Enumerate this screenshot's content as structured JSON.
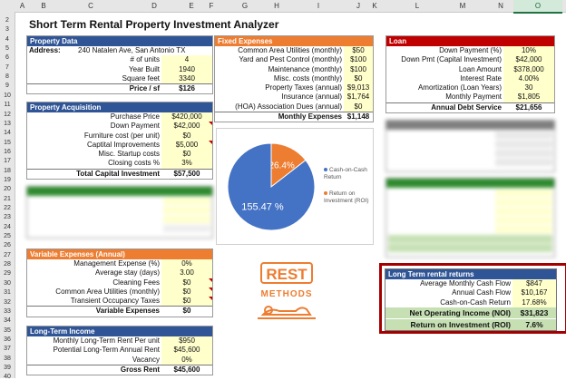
{
  "columns": [
    "A",
    "B",
    "C",
    "D",
    "E",
    "F",
    "G",
    "H",
    "I",
    "J",
    "K",
    "L",
    "M",
    "N",
    "O"
  ],
  "selected_column": "O",
  "rows": [
    "2",
    "3",
    "4",
    "5",
    "6",
    "7",
    "8",
    "9",
    "10",
    "11",
    "12",
    "13",
    "14",
    "15",
    "16",
    "17",
    "18",
    "19",
    "20",
    "21",
    "22",
    "23",
    "24",
    "25",
    "26",
    "27",
    "28",
    "29",
    "30",
    "31",
    "32",
    "33",
    "34",
    "35",
    "36",
    "37",
    "38",
    "39",
    "40"
  ],
  "title": "Short Term Rental Property Investment Analyzer",
  "property": {
    "header": "Property Data",
    "address_label": "Address:",
    "address": "240 Natalen Ave, San Antonio TX",
    "rows": [
      {
        "label": "# of units",
        "value": "4"
      },
      {
        "label": "Year Built",
        "value": "1940"
      },
      {
        "label": "Square feet",
        "value": "3340"
      }
    ],
    "price_sf_label": "Price / sf",
    "price_sf": "$126"
  },
  "acquisition": {
    "header": "Property Acquisition",
    "rows": [
      {
        "label": "Purchase Price",
        "value": "$420,000"
      },
      {
        "label": "Down Payment",
        "value": "$42,000"
      },
      {
        "label": "Furniture cost (per unit)",
        "value": "$0"
      },
      {
        "label": "Captital Improvements",
        "value": "$5,000"
      },
      {
        "label": "Misc. Startup costs",
        "value": "$0"
      },
      {
        "label": "Closing costs %",
        "value": "3%"
      }
    ],
    "total_label": "Total Capital Investment",
    "total": "$57,500"
  },
  "variable": {
    "header": "Variable Expenses (Annual)",
    "rows": [
      {
        "label": "Management Expense (%)",
        "value": "0%"
      },
      {
        "label": "Average stay (days)",
        "value": "3.00"
      },
      {
        "label": "Cleaning Fees",
        "value": "$0"
      },
      {
        "label": "Common Area Utilities (monthly)",
        "value": "$0"
      },
      {
        "label": "Transient Occupancy Taxes",
        "value": "$0"
      }
    ],
    "total_label": "Variable Expenses",
    "total": "$0"
  },
  "longterm_income": {
    "header": "Long-Term Income",
    "rows": [
      {
        "label": "Monthly Long-Term Rent Per unit",
        "value": "$950"
      },
      {
        "label": "Potential Long-Term  Annual Rent",
        "value": "$45,600"
      },
      {
        "label": "Vacancy",
        "value": "0%"
      }
    ],
    "total_label": "Gross Rent",
    "total": "$45,600"
  },
  "fixed": {
    "header": "Fixed Expenses",
    "rows": [
      {
        "label": "Common Area Utilities (monthly)",
        "value": "$50"
      },
      {
        "label": "Yard and Pest Control (monthly)",
        "value": "$100"
      },
      {
        "label": "Maintenance (monthly)",
        "value": "$100"
      },
      {
        "label": "Misc. costs (monthly)",
        "value": "$0"
      },
      {
        "label": "Property Taxes (annual)",
        "value": "$9,013"
      },
      {
        "label": "Insurance (annual)",
        "value": "$1,764"
      },
      {
        "label": "(HOA) Association Dues (annual)",
        "value": "$0"
      }
    ],
    "total_label": "Monthly Expenses",
    "total": "$1,148"
  },
  "loan": {
    "header": "Loan",
    "rows": [
      {
        "label": "Down Payment (%)",
        "value": "10%"
      },
      {
        "label": "Down Pmt (Capital Investment)",
        "value": "$42,000"
      },
      {
        "label": "Loan Amount",
        "value": "$378,000"
      },
      {
        "label": "Interest Rate",
        "value": "4.00%"
      },
      {
        "label": "Amortization (Loan Years)",
        "value": "30"
      },
      {
        "label": "Monthly Payment",
        "value": "$1,805"
      }
    ],
    "total_label": "Annual Debt Service",
    "total": "$21,656"
  },
  "returns": {
    "header": "Long Term rental returns",
    "rows": [
      {
        "label": "Average Monthly Cash Flow",
        "value": "$847"
      },
      {
        "label": "Annual Cash Flow",
        "value": "$10,167"
      },
      {
        "label": "Cash-on-Cash Return",
        "value": "17.68%"
      }
    ],
    "noi_label": "Net Operating Income (NOI)",
    "noi": "$31,823",
    "roi_label": "Return on Investment (ROI)",
    "roi": "7.6%"
  },
  "chart_data": {
    "type": "pie",
    "title": "",
    "slices": [
      {
        "name": "Cash-on-Cash Return",
        "label": "26.4%",
        "value": 26.4,
        "color": "#ed7d31"
      },
      {
        "name": "Return on Investment (ROI)",
        "label": "155.47 %",
        "value": 155.47,
        "color": "#4472c4"
      }
    ],
    "legend": [
      "Cash-on-Cash Return",
      "Return on Investment (ROI)"
    ],
    "legend_placement": "right"
  },
  "logo": {
    "line1": "REST",
    "line2": "METHODS"
  },
  "colors": {
    "blue": "#2f5597",
    "orange": "#ed7d31",
    "red": "#c00000",
    "green": "#2e8b2e",
    "input": "#ffffcc"
  }
}
